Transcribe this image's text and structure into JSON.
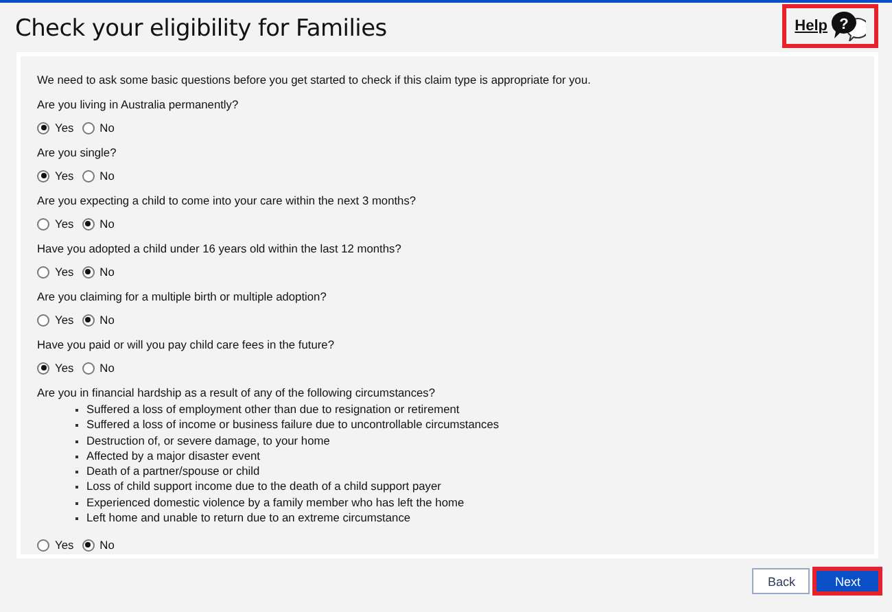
{
  "title": "Check your eligibility for Families",
  "help": {
    "label": "Help",
    "icon": "?",
    "highlighted": true
  },
  "intro": "We need to ask some basic questions before you get started to check if this claim type is appropriate for you.",
  "questions": [
    {
      "text": "Are you living in Australia permanently?",
      "options": [
        {
          "label": "Yes",
          "selected": true
        },
        {
          "label": "No",
          "selected": false
        }
      ]
    },
    {
      "text": "Are you single?",
      "options": [
        {
          "label": "Yes",
          "selected": true
        },
        {
          "label": "No",
          "selected": false
        }
      ]
    },
    {
      "text": "Are you expecting a child to come into your care within the next 3 months?",
      "options": [
        {
          "label": "Yes",
          "selected": false
        },
        {
          "label": "No",
          "selected": true
        }
      ]
    },
    {
      "text": "Have you adopted a child under 16 years old within the last 12 months?",
      "options": [
        {
          "label": "Yes",
          "selected": false
        },
        {
          "label": "No",
          "selected": true
        }
      ]
    },
    {
      "text": "Are you claiming for a multiple birth or multiple adoption?",
      "options": [
        {
          "label": "Yes",
          "selected": false
        },
        {
          "label": "No",
          "selected": true
        }
      ]
    },
    {
      "text": "Have you paid or will you pay child care fees in the future?",
      "options": [
        {
          "label": "Yes",
          "selected": true
        },
        {
          "label": "No",
          "selected": false
        }
      ]
    },
    {
      "text": "Are you in financial hardship as a result of any of the following circumstances?",
      "bullets": [
        "Suffered a loss of employment other than due to resignation or retirement",
        "Suffered a loss of income or business failure due to uncontrollable circumstances",
        "Destruction of, or severe damage, to your home",
        "Affected by a major disaster event",
        "Death of a partner/spouse or child",
        "Loss of child support income due to the death of a child support payer",
        "Experienced domestic violence by a family member who has left the home",
        "Left home and unable to return due to an extreme circumstance"
      ],
      "options": [
        {
          "label": "Yes",
          "selected": false
        },
        {
          "label": "No",
          "selected": true
        }
      ]
    }
  ],
  "buttons": [
    {
      "label": "Back",
      "kind": "secondary",
      "highlighted": false
    },
    {
      "label": "Next",
      "kind": "primary",
      "highlighted": true
    }
  ]
}
